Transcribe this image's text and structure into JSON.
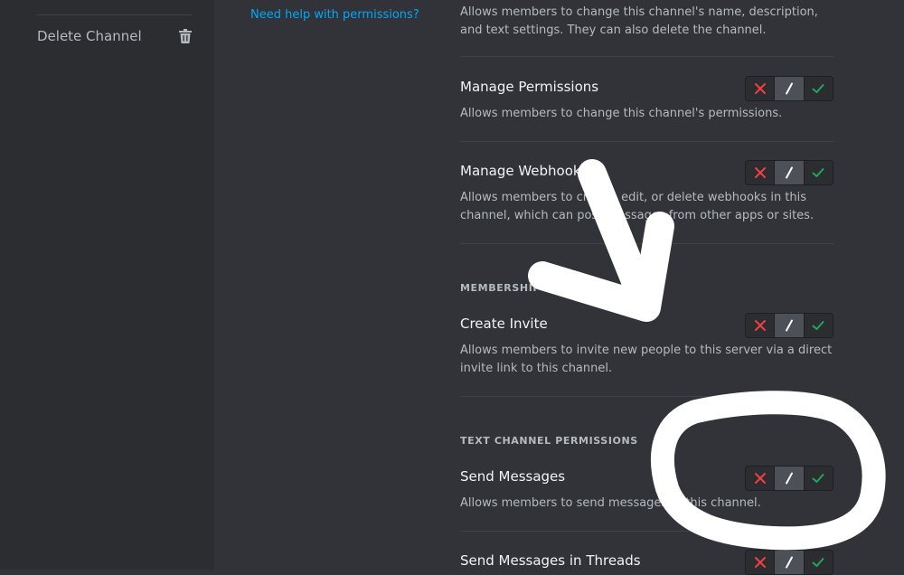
{
  "sidebar": {
    "delete_channel_label": "Delete Channel"
  },
  "middle": {
    "help_link": "Need help with permissions?"
  },
  "permissions": {
    "manage_channel_desc": "Allows members to change this channel's name, description, and text settings. They can also delete the channel.",
    "manage_permissions": {
      "title": "Manage Permissions",
      "desc": "Allows members to change this channel's permissions.",
      "state": "neutral"
    },
    "manage_webhooks": {
      "title": "Manage Webhooks",
      "desc": "Allows members to create, edit, or delete webhooks in this channel, which can post messages from other apps or sites.",
      "state": "neutral"
    },
    "membership_header": "MEMBERSHIP PERMISSIONS",
    "create_invite": {
      "title": "Create Invite",
      "desc": "Allows members to invite new people to this server via a direct invite link to this channel.",
      "state": "neutral"
    },
    "text_header": "TEXT CHANNEL PERMISSIONS",
    "send_messages": {
      "title": "Send Messages",
      "desc": "Allows members to send messages in this channel.",
      "state": "neutral"
    },
    "send_messages_threads": {
      "title": "Send Messages in Threads",
      "state": "neutral"
    }
  },
  "colors": {
    "deny": "#f23f43",
    "allow": "#23a55a",
    "link": "#00a8fc",
    "annotation": "#ffffff"
  },
  "icons": {
    "deny": "x-icon",
    "neutral": "slash-icon",
    "allow": "check-icon",
    "delete": "trash-icon"
  }
}
